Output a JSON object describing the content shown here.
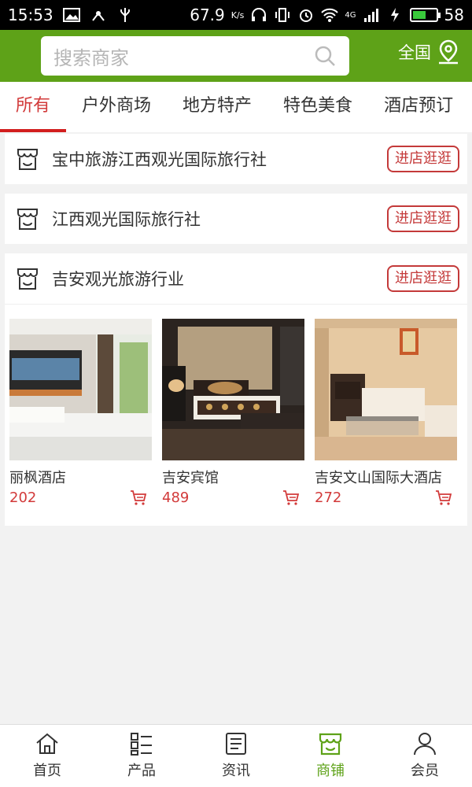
{
  "status_bar": {
    "time": "15:53",
    "speed": "67.9",
    "speed_unit": "K/s",
    "network": "4G",
    "battery_level": "58",
    "battery_fraction": 0.58
  },
  "header": {
    "search_placeholder": "搜索商家",
    "region_label": "全国",
    "accent_color": "#5ea218"
  },
  "tabs": [
    {
      "label": "所有",
      "active": true
    },
    {
      "label": "户外商场",
      "active": false
    },
    {
      "label": "地方特产",
      "active": false
    },
    {
      "label": "特色美食",
      "active": false
    },
    {
      "label": "酒店预订",
      "active": false
    }
  ],
  "shops": [
    {
      "name": "宝中旅游江西观光国际旅行社",
      "button": "进店逛逛"
    },
    {
      "name": "江西观光国际旅行社",
      "button": "进店逛逛"
    },
    {
      "name": "吉安观光旅游行业",
      "button": "进店逛逛"
    }
  ],
  "products": [
    {
      "name": "丽枫酒店",
      "price": "202"
    },
    {
      "name": "吉安宾馆",
      "price": "489"
    },
    {
      "name": "吉安文山国际大酒店",
      "price": "272"
    }
  ],
  "bottom_nav": [
    {
      "label": "首页",
      "icon": "home-icon",
      "active": false
    },
    {
      "label": "产品",
      "icon": "list-icon",
      "active": false
    },
    {
      "label": "资讯",
      "icon": "news-icon",
      "active": false
    },
    {
      "label": "商铺",
      "icon": "shop-icon",
      "active": true
    },
    {
      "label": "会员",
      "icon": "user-icon",
      "active": false
    }
  ]
}
